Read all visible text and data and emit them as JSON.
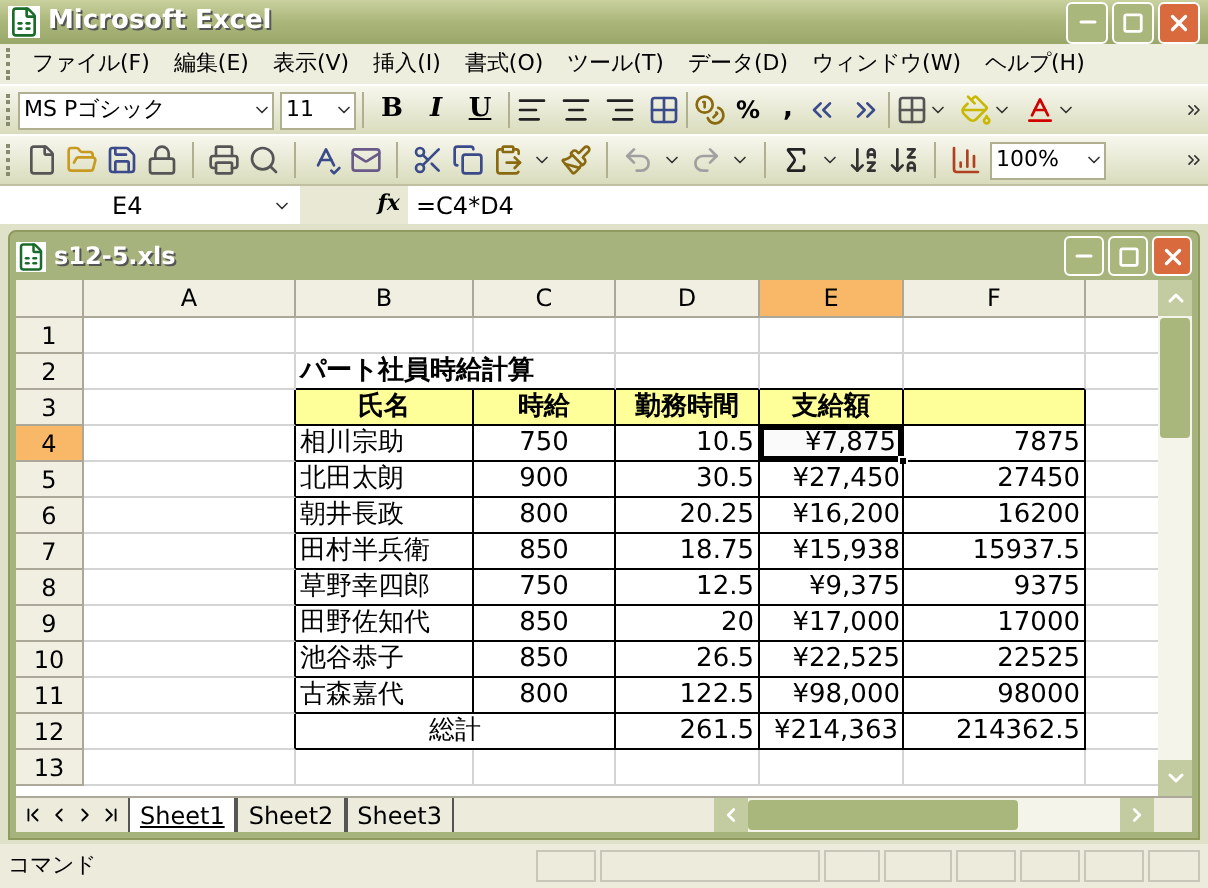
{
  "window": {
    "title": "Microsoft Excel"
  },
  "menu": [
    "ファイル(F)",
    "編集(E)",
    "表示(V)",
    "挿入(I)",
    "書式(O)",
    "ツール(T)",
    "データ(D)",
    "ウィンドウ(W)",
    "ヘルプ(H)"
  ],
  "formatting_toolbar": {
    "font": "MS Pゴシック",
    "size": "11",
    "bold": "B",
    "italic": "I",
    "underline": "U",
    "percent": "%",
    "comma": ","
  },
  "standard_toolbar": {
    "zoom": "100%"
  },
  "formula_bar": {
    "name_box": "E4",
    "function_label": "fx",
    "formula": "=C4*D4"
  },
  "workbook": {
    "title": "s12-5.xls",
    "columns": [
      {
        "label": "A",
        "selected": false
      },
      {
        "label": "B",
        "selected": false
      },
      {
        "label": "C",
        "selected": false
      },
      {
        "label": "D",
        "selected": false
      },
      {
        "label": "E",
        "selected": true
      },
      {
        "label": "F",
        "selected": false
      }
    ],
    "row_headers": [
      {
        "label": "1",
        "selected": false
      },
      {
        "label": "2",
        "selected": false
      },
      {
        "label": "3",
        "selected": false
      },
      {
        "label": "4",
        "selected": true
      },
      {
        "label": "5",
        "selected": false
      },
      {
        "label": "6",
        "selected": false
      },
      {
        "label": "7",
        "selected": false
      },
      {
        "label": "8",
        "selected": false
      },
      {
        "label": "9",
        "selected": false
      },
      {
        "label": "10",
        "selected": false
      },
      {
        "label": "11",
        "selected": false
      },
      {
        "label": "12",
        "selected": false
      },
      {
        "label": "13",
        "selected": false
      }
    ],
    "sheet_title": "パート社員時給計算",
    "table_headers": [
      "氏名",
      "時給",
      "勤務時間",
      "支給額"
    ],
    "rows": [
      {
        "name": "相川宗助",
        "wage": "750",
        "hours": "10.5",
        "pay": "¥7,875",
        "raw": "7875",
        "active": true
      },
      {
        "name": "北田太朗",
        "wage": "900",
        "hours": "30.5",
        "pay": "¥27,450",
        "raw": "27450",
        "active": false
      },
      {
        "name": "朝井長政",
        "wage": "800",
        "hours": "20.25",
        "pay": "¥16,200",
        "raw": "16200",
        "active": false
      },
      {
        "name": "田村半兵衛",
        "wage": "850",
        "hours": "18.75",
        "pay": "¥15,938",
        "raw": "15937.5",
        "active": false
      },
      {
        "name": "草野幸四郎",
        "wage": "750",
        "hours": "12.5",
        "pay": "¥9,375",
        "raw": "9375",
        "active": false
      },
      {
        "name": "田野佐知代",
        "wage": "850",
        "hours": "20",
        "pay": "¥17,000",
        "raw": "17000",
        "active": false
      },
      {
        "name": "池谷恭子",
        "wage": "850",
        "hours": "26.5",
        "pay": "¥22,525",
        "raw": "22525",
        "active": false
      },
      {
        "name": "古森嘉代",
        "wage": "800",
        "hours": "122.5",
        "pay": "¥98,000",
        "raw": "98000",
        "active": false
      }
    ],
    "total": {
      "label": "総計",
      "hours": "261.5",
      "pay": "¥214,363",
      "raw": "214362.5"
    },
    "sheet_tabs": [
      {
        "label": "Sheet1",
        "selected": true
      },
      {
        "label": "Sheet2",
        "selected": false
      },
      {
        "label": "Sheet3",
        "selected": false
      }
    ]
  },
  "status_bar": {
    "text": "コマンド"
  }
}
